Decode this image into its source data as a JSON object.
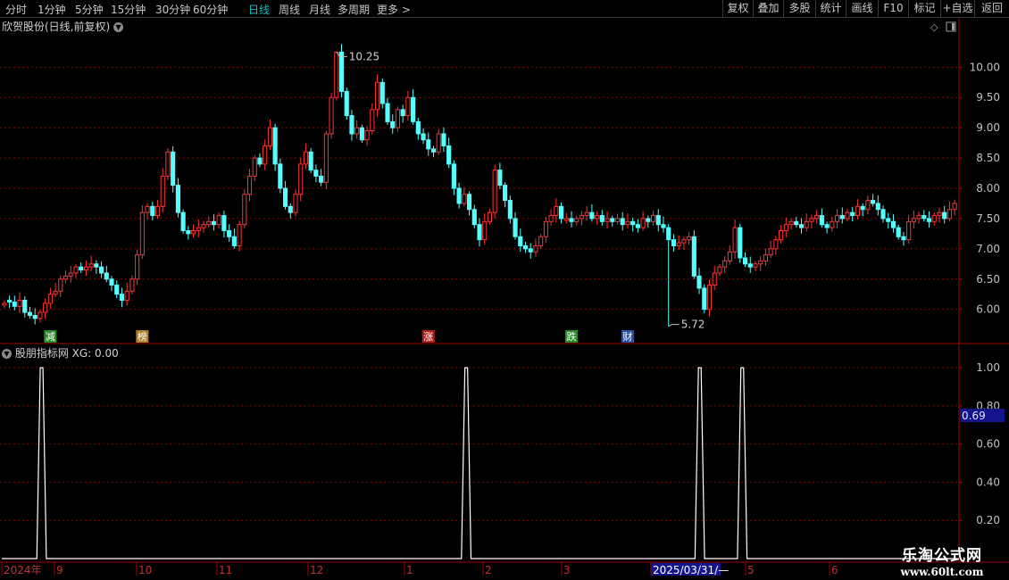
{
  "toolbar": {
    "periods": [
      {
        "label": "分时",
        "active": false
      },
      {
        "label": "1分钟",
        "active": false
      },
      {
        "label": "5分钟",
        "active": false
      },
      {
        "label": "15分钟",
        "active": false
      },
      {
        "label": "30分钟",
        "active": false
      },
      {
        "label": "60分钟",
        "active": false
      },
      {
        "label": "日线",
        "active": true
      },
      {
        "label": "周线",
        "active": false
      },
      {
        "label": "月线",
        "active": false
      },
      {
        "label": "多周期",
        "active": false
      },
      {
        "label": "更多 >",
        "active": false
      }
    ],
    "actions": [
      "复权",
      "叠加",
      "多股",
      "统计",
      "画线",
      "F10",
      "标记",
      "+自选",
      "返回"
    ]
  },
  "main_panel": {
    "title": "欣贺股份(日线,前复权)",
    "max_label": "10.25",
    "min_label": "5.72",
    "tags": [
      {
        "text": "减",
        "color": "#2a8a2a",
        "index": 9
      },
      {
        "text": "榜",
        "color": "#b07c2a",
        "index": 27
      },
      {
        "text": "涨",
        "color": "#a82020",
        "index": 83
      },
      {
        "text": "跌",
        "color": "#2a8a2a",
        "index": 111
      },
      {
        "text": "财",
        "color": "#2b4fa0",
        "index": 122
      }
    ]
  },
  "sub_panel": {
    "title": "股朋指标网 XG: 0.00",
    "cursor_value": "0.69"
  },
  "date_axis": {
    "labels": [
      "2024年",
      "9",
      "10",
      "11",
      "12",
      "1",
      "2",
      "3",
      "2025/03/31/—",
      "5",
      "6"
    ]
  },
  "watermark": {
    "title": "乐淘公式网",
    "url": "www.60lt.com"
  },
  "colors": {
    "up": "#ff3232",
    "down": "#54ffff",
    "grid": "#8b0000",
    "axis": "#a00000",
    "indicator": "#ffffff",
    "cursor_bg": "#14148c"
  },
  "chart_data": [
    {
      "type": "candlestick",
      "title": "欣贺股份(日线,前复权)",
      "ylim": [
        5.45,
        10.55
      ],
      "y_ticks": [
        6.0,
        6.5,
        7.0,
        7.5,
        8.0,
        8.5,
        9.0,
        9.5,
        10.0
      ],
      "series": [
        {
          "name": "close",
          "values": [
            6.1,
            6.12,
            6.05,
            6.15,
            5.95,
            5.9,
            5.85,
            5.95,
            6.1,
            6.25,
            6.3,
            6.5,
            6.55,
            6.6,
            6.7,
            6.65,
            6.7,
            6.75,
            6.7,
            6.6,
            6.5,
            6.4,
            6.25,
            6.15,
            6.3,
            6.5,
            6.9,
            7.6,
            7.7,
            7.55,
            7.7,
            8.2,
            8.6,
            8.05,
            7.6,
            7.3,
            7.25,
            7.3,
            7.35,
            7.4,
            7.45,
            7.4,
            7.55,
            7.3,
            7.2,
            7.05,
            7.4,
            7.9,
            8.2,
            8.5,
            8.4,
            8.7,
            9.0,
            8.4,
            8.0,
            7.7,
            7.6,
            7.9,
            8.4,
            8.6,
            8.3,
            8.2,
            8.1,
            8.9,
            9.5,
            10.25,
            9.6,
            9.2,
            8.9,
            9.0,
            8.8,
            8.95,
            9.3,
            9.75,
            9.4,
            9.1,
            9.0,
            9.3,
            9.2,
            9.5,
            9.1,
            8.9,
            8.8,
            8.65,
            8.6,
            8.9,
            8.7,
            8.4,
            8.0,
            7.75,
            7.9,
            7.65,
            7.4,
            7.15,
            7.45,
            7.6,
            8.3,
            8.05,
            7.8,
            7.5,
            7.2,
            7.05,
            7.0,
            6.95,
            7.05,
            7.2,
            7.45,
            7.55,
            7.7,
            7.5,
            7.5,
            7.45,
            7.5,
            7.55,
            7.6,
            7.5,
            7.55,
            7.45,
            7.5,
            7.45,
            7.5,
            7.4,
            7.45,
            7.4,
            7.35,
            7.5,
            7.45,
            7.55,
            7.4,
            7.35,
            7.15,
            7.05,
            7.1,
            7.15,
            7.2,
            6.55,
            6.35,
            6.0,
            6.4,
            6.6,
            6.7,
            6.8,
            6.95,
            7.35,
            6.85,
            6.75,
            6.7,
            6.75,
            6.8,
            6.9,
            7.0,
            7.15,
            7.3,
            7.4,
            7.45,
            7.4,
            7.35,
            7.45,
            7.5,
            7.55,
            7.4,
            7.35,
            7.45,
            7.55,
            7.5,
            7.6,
            7.55,
            7.7,
            7.65,
            7.8,
            7.75,
            7.65,
            7.5,
            7.45,
            7.35,
            7.2,
            7.15,
            7.45,
            7.5,
            7.55,
            7.5,
            7.45,
            7.55,
            7.6,
            7.5,
            7.65,
            7.75
          ]
        },
        {
          "name": "max",
          "x_index": 65,
          "value": 10.25
        },
        {
          "name": "min",
          "x_index": 130,
          "value": 5.72
        }
      ]
    },
    {
      "type": "line",
      "title": "股朋指标网 XG: 0.00",
      "ylim": [
        0.0,
        1.08
      ],
      "y_ticks": [
        0.2,
        0.4,
        0.6,
        0.8,
        1.0
      ],
      "series": [
        {
          "name": "XG",
          "spike_indices": [
            7,
            87,
            131,
            139
          ],
          "spike_value": 1.0,
          "base_value": 0.0
        }
      ],
      "categories_count": 180
    }
  ]
}
